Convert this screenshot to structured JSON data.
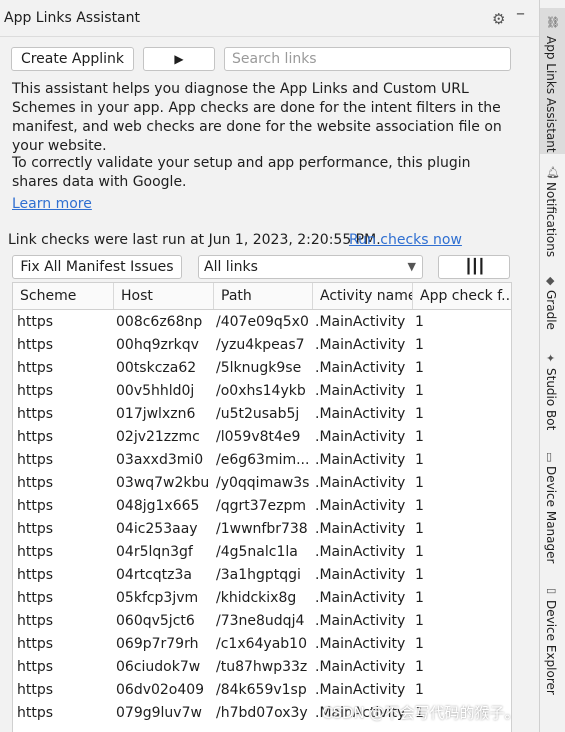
{
  "window": {
    "title": "App Links Assistant"
  },
  "toolbar": {
    "create_label": "Create Applink",
    "run_icon": "▶",
    "search_placeholder": "Search links"
  },
  "intro": {
    "paragraph1": "This assistant helps you diagnose the App Links and Custom URL Schemes in your app. App checks are done for the intent filters in the manifest, and web checks are done for the website association file on your website.",
    "paragraph2": "To correctly validate your setup and app performance, this plugin shares data with Google.",
    "learn_more": "Learn more"
  },
  "status": {
    "text": "Link checks were last run at Jun 1, 2023, 2:20:55 PM.",
    "run_link": "Run checks now"
  },
  "filters": {
    "fix_label": "Fix All Manifest Issues",
    "select_value": "All links",
    "columns_icon": "‖‖"
  },
  "table": {
    "headers": [
      "Scheme",
      "Host",
      "Path",
      "Activity name",
      "App check f..."
    ],
    "rows": [
      [
        "https",
        "008c6z68np",
        "/407e09q5x0",
        ".MainActivity",
        "1"
      ],
      [
        "https",
        "00hq9zrkqv",
        "/yzu4kpeas7",
        ".MainActivity",
        "1"
      ],
      [
        "https",
        "00tskcza62",
        "/5lknugk9se",
        ".MainActivity",
        "1"
      ],
      [
        "https",
        "00v5hhld0j",
        "/o0xhs14ykb",
        ".MainActivity",
        "1"
      ],
      [
        "https",
        "017jwlxzn6",
        "/u5t2usab5j",
        ".MainActivity",
        "1"
      ],
      [
        "https",
        "02jv21zzmc",
        "/l059v8t4e9",
        ".MainActivity",
        "1"
      ],
      [
        "https",
        "03axxd3mi0",
        "/e6g63mim...",
        ".MainActivity",
        "1"
      ],
      [
        "https",
        "03wq7w2kbu",
        "/y0qqimaw3s",
        ".MainActivity",
        "1"
      ],
      [
        "https",
        "048jg1x665",
        "/qgrt37ezpm",
        ".MainActivity",
        "1"
      ],
      [
        "https",
        "04ic253aay",
        "/1wwnfbr738",
        ".MainActivity",
        "1"
      ],
      [
        "https",
        "04r5lqn3gf",
        "/4g5nalc1la",
        ".MainActivity",
        "1"
      ],
      [
        "https",
        "04rtcqtz3a",
        "/3a1hgptqgi",
        ".MainActivity",
        "1"
      ],
      [
        "https",
        "05kfcp3jvm",
        "/khidckix8g",
        ".MainActivity",
        "1"
      ],
      [
        "https",
        "060qv5jct6",
        "/73ne8udqj4",
        ".MainActivity",
        "1"
      ],
      [
        "https",
        "069p7r79rh",
        "/c1x64yab10",
        ".MainActivity",
        "1"
      ],
      [
        "https",
        "06ciudok7w",
        "/tu87hwp33z",
        ".MainActivity",
        "1"
      ],
      [
        "https",
        "06dv02o409",
        "/84k659v1sp",
        ".MainActivity",
        "1"
      ],
      [
        "https",
        "079g9luv7w",
        "/h7bd07ox3y",
        ".MainActivity",
        "1"
      ]
    ]
  },
  "side_rail": [
    "App Links Assistant",
    "Notifications",
    "Gradle",
    "Studio Bot",
    "Device Manager",
    "Device Explorer"
  ],
  "watermark": "CSDN @不会写代码的猴子。"
}
